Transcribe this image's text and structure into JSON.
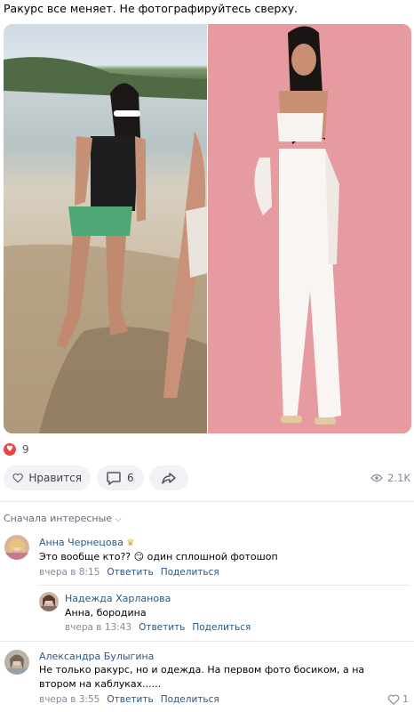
{
  "post": {
    "text": "Ракурс все меняет. Не фотографируйтесь сверху.",
    "reactions_count": "9",
    "like_label": "Нравится",
    "comments_count": "6",
    "views": "2.1K"
  },
  "comments": {
    "sort_label": "Сначала интересные",
    "items": [
      {
        "author": "Анна Чернецова",
        "text": "Это вообще кто?? 😏 один сплошной фотошоп",
        "time": "вчера в 8:15",
        "reply": "Ответить",
        "share": "Поделиться"
      },
      {
        "author": "Надежда Харланова",
        "text": "Анна, бородина",
        "time": "вчера в 13:43",
        "reply": "Ответить",
        "share": "Поделиться"
      },
      {
        "author": "Александра Булыгина",
        "text": "Не только ракурс, но и одежда. На первом фото босиком, а на втором на каблуках......",
        "time": "вчера в 3:55",
        "reply": "Ответить",
        "share": "Поделиться",
        "likes": "1"
      }
    ]
  },
  "colors": {
    "accent_link": "#2a5885",
    "meta": "#818c99",
    "heart": "#e64646",
    "button_bg": "#f0f2f5"
  },
  "icons": [
    "heart-icon",
    "comment-icon",
    "share-icon",
    "eye-icon",
    "chevron-down-icon",
    "crown-icon"
  ]
}
